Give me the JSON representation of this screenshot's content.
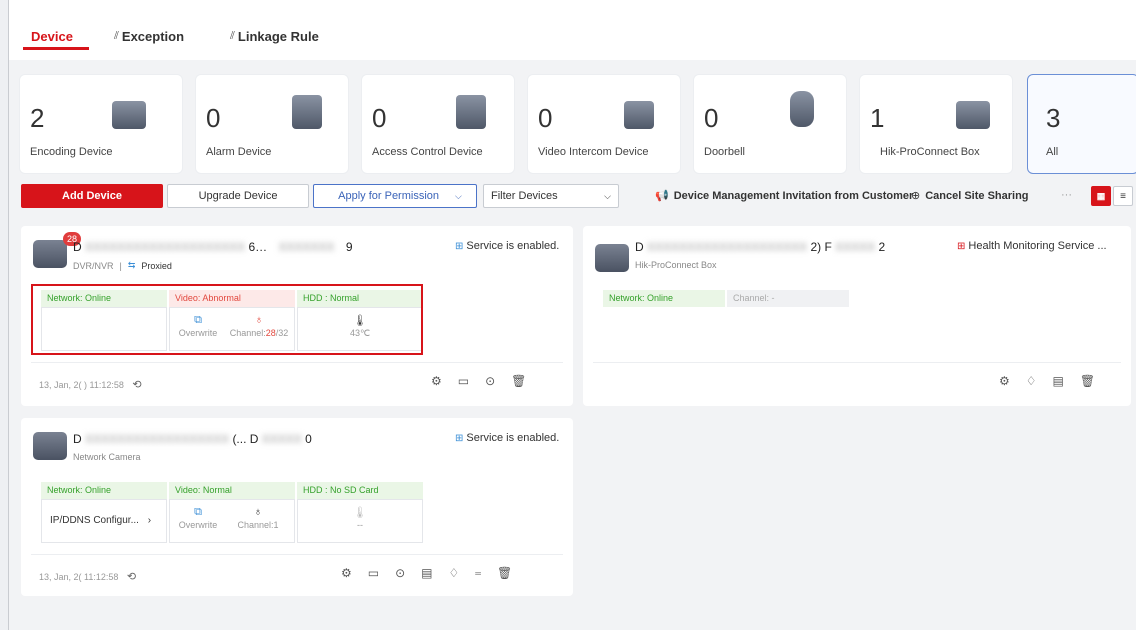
{
  "tabs": [
    {
      "label": "Device",
      "icon": ""
    },
    {
      "label": "Exception",
      "icon": "chart-icon"
    },
    {
      "label": "Linkage Rule",
      "icon": "chart-icon"
    }
  ],
  "cards": [
    {
      "count": "2",
      "label": "Encoding Device",
      "icon": "nvr-icon"
    },
    {
      "count": "0",
      "label": "Alarm Device",
      "icon": "alarm-device-icon"
    },
    {
      "count": "0",
      "label": "Access Control Device",
      "icon": "access-control-icon"
    },
    {
      "count": "0",
      "label": "Video Intercom Device",
      "icon": "intercom-icon"
    },
    {
      "count": "0",
      "label": "Doorbell",
      "icon": "doorbell-icon"
    },
    {
      "count": "1",
      "label": "Hik-ProConnect Box",
      "icon": "cloud-box-icon"
    },
    {
      "count": "3",
      "label": "All",
      "icon": ""
    }
  ],
  "toolbar": {
    "add": "Add Device",
    "upgrade": "Upgrade Device",
    "permission": "Apply for Permission",
    "filter": "Filter Devices",
    "invitation": "Device Management Invitation from Customer",
    "cancel_sharing": "Cancel Site Sharing",
    "more": "···"
  },
  "devices": [
    {
      "badge": "28",
      "name_prefix": "D",
      "name_hidden": "XXXXXXXXXXXXXXXXXXXX",
      "name_mid": "6…",
      "name_suffix": "9",
      "type": "DVR/NVR",
      "proxy": "Proxied",
      "service": "Service is enabled.",
      "network": "Network: Online",
      "video": "Video: Abnormal",
      "hdd": "HDD : Normal",
      "overwrite": "Overwrite",
      "channel_label": "Channel:",
      "channel_abnormal": "28",
      "channel_total": "/32",
      "temperature": "43℃",
      "timestamp": "13, Jan, 2( ) 11:12:58"
    },
    {
      "name_prefix": "D",
      "name_hidden": "XXXXXXXXXXXXXXXXXXXX",
      "name_mid": "2)  F",
      "name_suffix": "2",
      "type": "Hik-ProConnect Box",
      "service": "Health Monitoring Service ...",
      "network": "Network: Online",
      "channel": "Channel: -"
    },
    {
      "name_prefix": "D",
      "name_hidden": "XXXXXXXXXXXXXXXXXX",
      "name_mid": "(... D",
      "name_suffix": "0",
      "type": "Network Camera",
      "service": "Service is enabled.",
      "network": "Network: Online",
      "video": "Video: Normal",
      "hdd": "HDD : No SD Card",
      "ipddns": "IP/DDNS Configur...",
      "overwrite": "Overwrite",
      "channel": "Channel:1",
      "hdd_value": "--",
      "timestamp": "13, Jan, 2(   11:12:58"
    }
  ],
  "colors": {
    "accent": "#d7141a",
    "blue": "#3a63b8",
    "online": "#35a12b",
    "abnormal": "#e2483e"
  }
}
